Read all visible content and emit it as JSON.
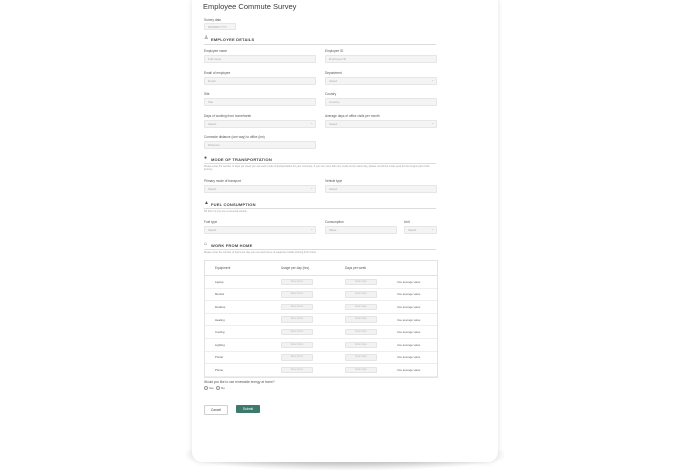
{
  "form": {
    "title": "Employee Commute Survey",
    "survey_label": "Survey date",
    "survey_value": "DD/MM/YYYY"
  },
  "employee": {
    "section_title": "EMPLOYEE DETAILS",
    "section_icon": "user-icon",
    "name_label": "Employee name",
    "name_placeholder": "Full name",
    "id_label": "Employee ID",
    "id_placeholder": "Employee ID",
    "email_label": "Email of employee",
    "email_placeholder": "Email",
    "dept_label": "Department",
    "dept_placeholder": "Select",
    "site_label": "Site",
    "site_placeholder": "Site",
    "country_label": "Country",
    "country_placeholder": "Country",
    "days_label": "Days of working from home/week",
    "days_placeholder": "Select",
    "travel_label": "Average days of office visits per month",
    "travel_placeholder": "Select",
    "distance_label": "Commute distance (one way) to office (km)",
    "distance_placeholder": "Distance"
  },
  "transport": {
    "section_title": "MODE OF TRANSPORTATION",
    "section_icon": "car-icon",
    "note": "Please enter the number of days per week you use each mode of transportation for your commute. If you use more than one mode on the same day, please record the mode used for the longest part of the journey.",
    "mode_label": "Primary mode of transport",
    "mode_placeholder": "Select",
    "type_label": "Vehicle type",
    "type_placeholder": "Select"
  },
  "fuel": {
    "section_title": "FUEL CONSUMPTION",
    "section_icon": "fuel-icon",
    "note": "Fill this in if you use a personal vehicle.",
    "fuel_label": "Fuel type",
    "fuel_placeholder": "Select",
    "consumption_label": "Consumption",
    "consumption_placeholder": "Value",
    "unit_label": "Unit",
    "unit_placeholder": "Select"
  },
  "wfh": {
    "section_title": "WORK FROM HOME",
    "section_icon": "home-icon",
    "note": "Please enter the number of hours per day you use each piece of equipment while working from home.",
    "col_equipment": "Equipment",
    "col_hours": "Usage per day (hrs)",
    "col_days": "Days per week",
    "rows": [
      {
        "name": "Laptop",
        "hours": "Enter hours",
        "days": "Enter days",
        "action": "Use average value"
      },
      {
        "name": "Monitor",
        "hours": "Enter hours",
        "days": "Enter days",
        "action": "Use average value"
      },
      {
        "name": "Desktop",
        "hours": "Enter hours",
        "days": "Enter days",
        "action": "Use average value"
      },
      {
        "name": "Heating",
        "hours": "Enter hours",
        "days": "Enter days",
        "action": "Use average value"
      },
      {
        "name": "Cooling",
        "hours": "Enter hours",
        "days": "Enter days",
        "action": "Use average value"
      },
      {
        "name": "Lighting",
        "hours": "Enter hours",
        "days": "Enter days",
        "action": "Use average value"
      },
      {
        "name": "Printer",
        "hours": "Enter hours",
        "days": "Enter days",
        "action": "Use average value"
      },
      {
        "name": "Phone",
        "hours": "Enter hours",
        "days": "Enter days",
        "action": "Use average value"
      }
    ]
  },
  "consent": {
    "question": "Would you like to use renewable energy at home?",
    "yes": "Yes",
    "no": "No"
  },
  "actions": {
    "cancel": "Cancel",
    "submit": "Submit"
  },
  "colors": {
    "accent": "#3d7a6d"
  }
}
